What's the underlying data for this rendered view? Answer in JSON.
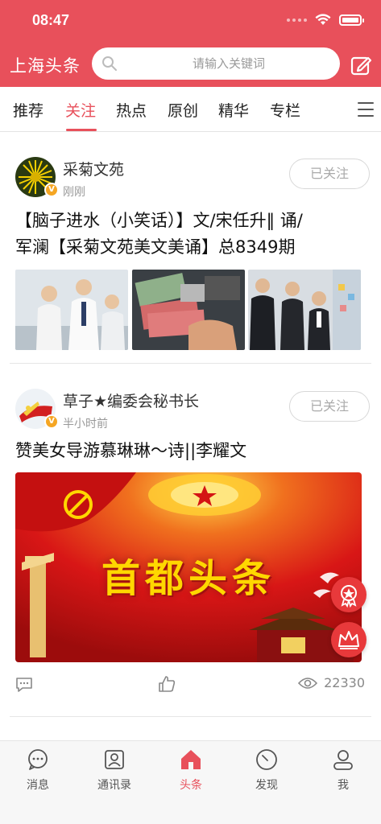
{
  "status_bar": {
    "time": "08:47"
  },
  "header": {
    "title": "上海头条",
    "search_placeholder": "请输入关键词"
  },
  "tabs": [
    {
      "label": "推荐",
      "active": false
    },
    {
      "label": "关注",
      "active": true
    },
    {
      "label": "热点",
      "active": false
    },
    {
      "label": "原创",
      "active": false
    },
    {
      "label": "精华",
      "active": false
    },
    {
      "label": "专栏",
      "active": false
    }
  ],
  "posts": [
    {
      "author": "采菊文苑",
      "time": "刚刚",
      "follow_label": "已关注",
      "title_line1": "【脑子进水（小笑话）】文/宋任升‖ 诵/",
      "title_line2": "军澜【采菊文苑美文美诵】总8349期"
    },
    {
      "author": "草子★编委会秘书长",
      "time": "半小时前",
      "follow_label": "已关注",
      "title": "赞美女导游慕琳琳～诗||李耀文",
      "banner_text": "首都头条",
      "views": "22330"
    }
  ],
  "bottom_nav": [
    {
      "label": "消息",
      "icon": "chat-icon",
      "active": false
    },
    {
      "label": "通讯录",
      "icon": "contacts-icon",
      "active": false
    },
    {
      "label": "头条",
      "icon": "home-icon",
      "active": true
    },
    {
      "label": "发现",
      "icon": "compass-icon",
      "active": false
    },
    {
      "label": "我",
      "icon": "user-icon",
      "active": false
    }
  ],
  "colors": {
    "brand": "#e8505b",
    "badge": "#f5a623",
    "float_button": "#e8393b"
  }
}
